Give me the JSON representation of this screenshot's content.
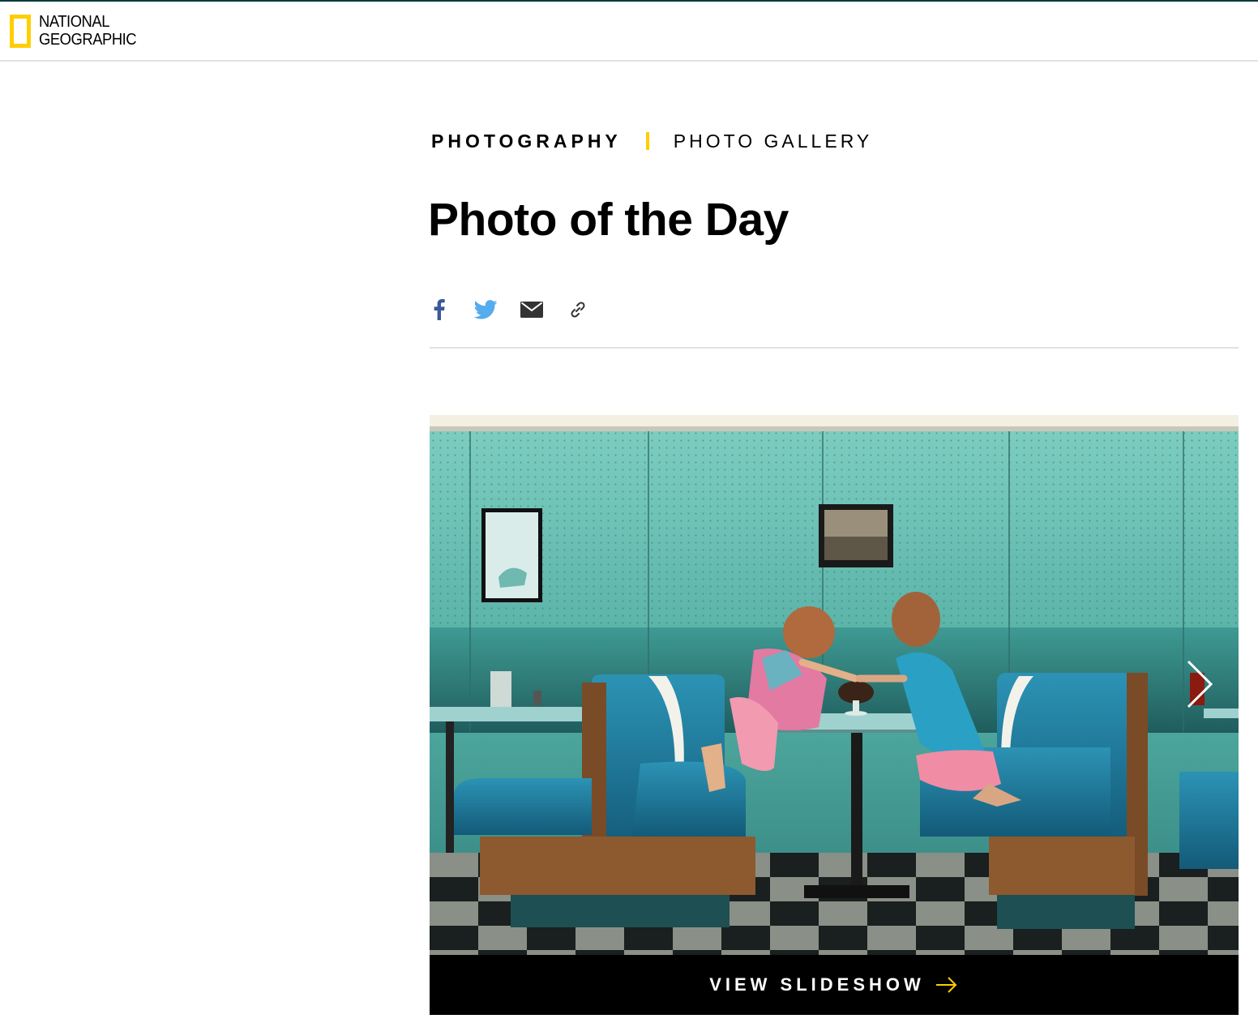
{
  "brand": {
    "line1": "NATIONAL",
    "line2": "GEOGRAPHIC",
    "accent_color": "#ffce00"
  },
  "breadcrumb": {
    "primary": "PHOTOGRAPHY",
    "secondary": "PHOTO GALLERY"
  },
  "page": {
    "title": "Photo of the Day"
  },
  "share": {
    "icons": [
      "facebook-icon",
      "twitter-icon",
      "email-icon",
      "link-icon"
    ],
    "colors": {
      "facebook": "#3b5998",
      "twitter": "#55acee",
      "email": "#333333",
      "link": "#333333"
    }
  },
  "gallery": {
    "image_alt": "Two girls sharing an ice cream sundae in a teal diner booth",
    "cta_label": "VIEW SLIDESHOW",
    "next_icon": "chevron-right-icon",
    "cta_icon": "arrow-right-icon",
    "cta_arrow_color": "#ffce00"
  }
}
